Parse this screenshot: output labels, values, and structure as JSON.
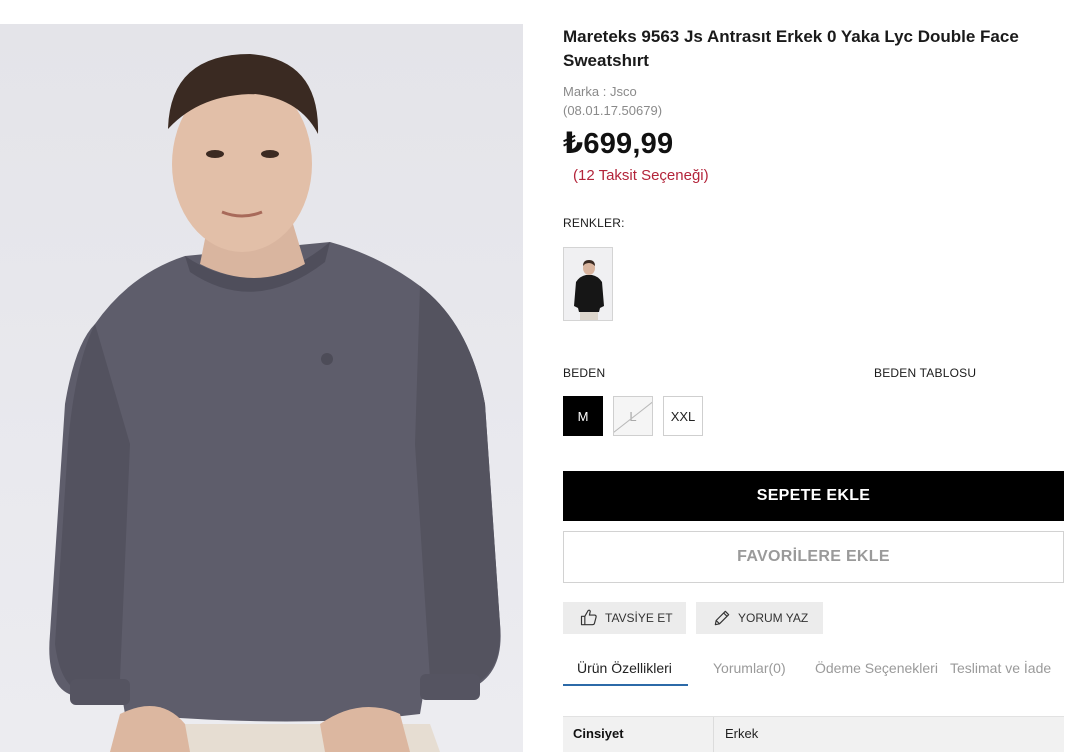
{
  "product": {
    "title": "Mareteks 9563 Js Antrasıt Erkek 0 Yaka Lyc Double Face Sweatshırt",
    "brand": "Marka : Jsco",
    "sku": "(08.01.17.50679)",
    "price": "₺699,99",
    "installment": "(12 Taksit Seçeneği)"
  },
  "colors": {
    "label": "RENKLER:"
  },
  "sizes": {
    "label": "BEDEN",
    "size_table_link": "BEDEN TABLOSU",
    "options": [
      "M",
      "L",
      "XXL"
    ],
    "selected": "M",
    "unavailable": [
      "L"
    ]
  },
  "actions": {
    "add_to_cart": "SEPETE EKLE",
    "add_to_favorites": "FAVORİLERE EKLE",
    "recommend": "TAVSİYE ET",
    "write_review": "YORUM YAZ"
  },
  "tabs": [
    {
      "label": "Ürün Özellikleri"
    },
    {
      "label": "Yorumlar(0)"
    },
    {
      "label": "Ödeme Seçenekleri"
    },
    {
      "label": "Teslimat ve İade"
    }
  ],
  "specs": [
    {
      "key": "Cinsiyet",
      "value": "Erkek"
    }
  ],
  "icons": {
    "recommend": "thumbs-up-icon",
    "review": "pencil-icon"
  },
  "colors_palette": {
    "price_red": "#b3243a",
    "tab_active": "#2c6aa8",
    "sweatshirt": "#5e5d6b"
  }
}
